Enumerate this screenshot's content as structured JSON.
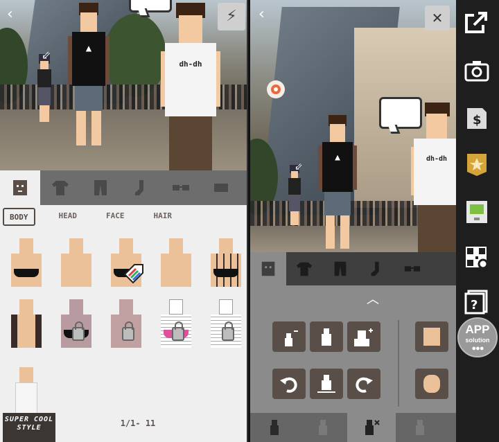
{
  "left_screen": {
    "back_icon": "back-chevron-icon",
    "flash_icon": "lightning-bolt-icon",
    "character_logo_text": "dh-dh",
    "tabs": [
      {
        "name": "body-tab",
        "icon": "face-icon",
        "active": true
      },
      {
        "name": "shirt-tab",
        "icon": "shirt-icon",
        "active": false
      },
      {
        "name": "pants-tab",
        "icon": "pants-icon",
        "active": false
      },
      {
        "name": "socks-tab",
        "icon": "sock-icon",
        "active": false
      },
      {
        "name": "glasses-tab",
        "icon": "glasses-icon",
        "active": false
      },
      {
        "name": "hat-tab",
        "icon": "hat-icon",
        "active": false
      }
    ],
    "subtabs": [
      {
        "label": "BODY",
        "active": true
      },
      {
        "label": "HEAD",
        "active": false
      },
      {
        "label": "FACE",
        "active": false
      },
      {
        "label": "HAIR",
        "active": false
      }
    ],
    "items": [
      {
        "variant": "bra",
        "locked": false
      },
      {
        "variant": "shirtless",
        "locked": false
      },
      {
        "variant": "bra",
        "locked": false,
        "tag": "colors-tag"
      },
      {
        "variant": "shirtless",
        "locked": false
      },
      {
        "variant": "tattoo-bra",
        "locked": false
      },
      {
        "variant": "tattoo",
        "locked": false
      },
      {
        "variant": "zombie-bra",
        "locked": true
      },
      {
        "variant": "zombie",
        "locked": true
      },
      {
        "variant": "skeleton-bra",
        "locked": true
      },
      {
        "variant": "skeleton",
        "locked": true
      },
      {
        "variant": "tank-top",
        "locked": false
      }
    ],
    "pager": "1/1- 11",
    "brand_logo": "SUPER COOL STYLE"
  },
  "right_screen": {
    "back_icon": "back-chevron-icon",
    "close_icon": "close-x-icon",
    "character_logo_text": "dh-dh",
    "collapse_icon": "chevron-up-icon",
    "controls": [
      {
        "name": "shrink-button",
        "icon": "shrink-figure-icon"
      },
      {
        "name": "reset-size-button",
        "icon": "figure-icon"
      },
      {
        "name": "grow-button",
        "icon": "grow-figure-icon"
      },
      {
        "name": "rotate-left-button",
        "icon": "rotate-left-icon"
      },
      {
        "name": "align-bottom-button",
        "icon": "figure-baseline-icon"
      },
      {
        "name": "rotate-right-button",
        "icon": "rotate-right-icon"
      }
    ],
    "layer_faces": [
      "face-icon",
      "face-icon"
    ],
    "bottom_tabs": [
      {
        "icon": "figure-icon",
        "active": false
      },
      {
        "icon": "figure-icon",
        "active": false
      },
      {
        "icon": "figure-delete-icon",
        "active": true
      },
      {
        "icon": "figure-icon",
        "active": false
      }
    ]
  },
  "sidebar": {
    "items": [
      {
        "name": "share-button",
        "icon": "share-arrow-icon"
      },
      {
        "name": "camera-button",
        "icon": "camera-icon"
      },
      {
        "name": "store-button",
        "icon": "dollar-card-icon"
      },
      {
        "name": "favorites-button",
        "icon": "star-badge-icon"
      },
      {
        "name": "gameboy-button",
        "icon": "handheld-icon"
      },
      {
        "name": "qr-button",
        "icon": "qr-code-icon"
      },
      {
        "name": "help-button",
        "icon": "help-icon"
      }
    ],
    "watermark_line1": "APP",
    "watermark_line2": "solution"
  }
}
